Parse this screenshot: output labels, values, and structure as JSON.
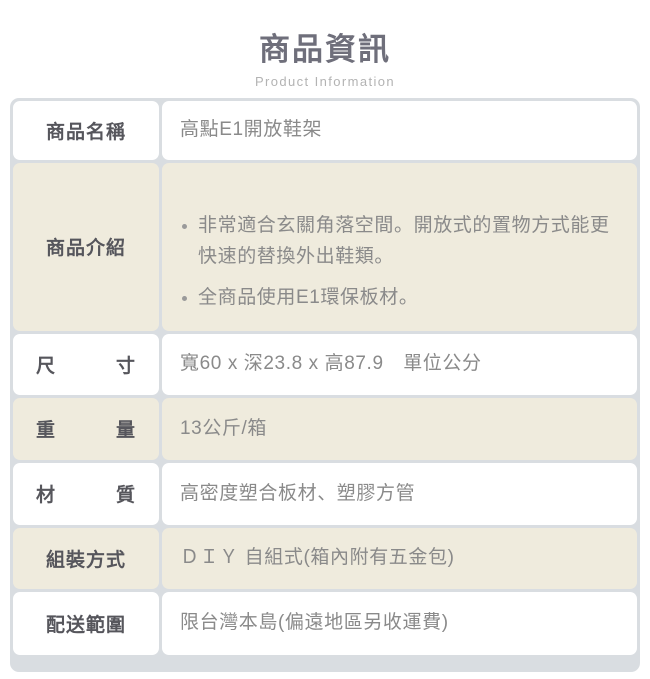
{
  "header": {
    "title": "商品資訊",
    "subtitle": "Product Information"
  },
  "colors": {
    "page_background": "#ffffff",
    "table_background": "#d9dde1",
    "row_white": "#ffffff",
    "row_beige": "#efebdd",
    "title_text": "#6f6f7b",
    "subtitle_text": "#b3b3b3",
    "label_text": "#56565c",
    "value_text": "#8a8a8a"
  },
  "table": {
    "rows": [
      {
        "label": "商品名稱",
        "value": "高點E1開放鞋架",
        "shade": "white"
      },
      {
        "label": "商品介紹",
        "bullets": [
          "非常適合玄關角落空間。開放式的置物方式能更快速的替換外出鞋類。",
          "全商品使用E1環保板材。"
        ],
        "shade": "beige"
      },
      {
        "label": "尺　寸",
        "label_chars": "尺寸",
        "value": "寬60 x 深23.8 x 高87.9　單位公分",
        "shade": "white"
      },
      {
        "label": "重　量",
        "label_chars": "重量",
        "value": "13公斤/箱",
        "shade": "beige"
      },
      {
        "label": "材　質",
        "label_chars": "材質",
        "value": "高密度塑合板材、塑膠方管",
        "shade": "white"
      },
      {
        "label": "組裝方式",
        "value": "ＤＩＹ 自組式(箱內附有五金包)",
        "shade": "beige"
      },
      {
        "label": "配送範圍",
        "value": "限台灣本島(偏遠地區另收運費)",
        "shade": "white"
      }
    ]
  }
}
